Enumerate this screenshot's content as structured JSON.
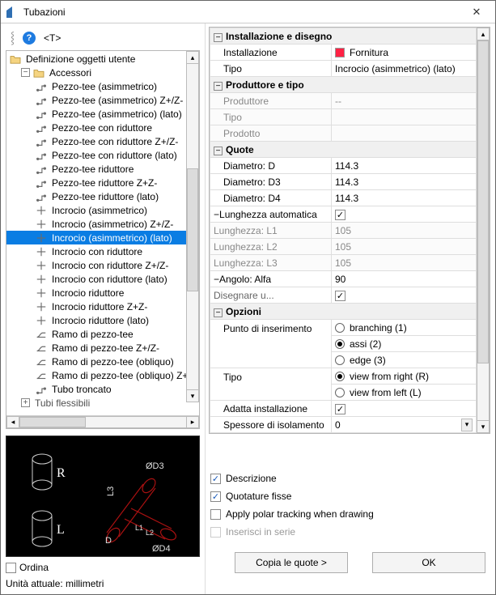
{
  "window": {
    "title": "Tubazioni"
  },
  "toolbar": {
    "t_label": "<T>"
  },
  "tree": {
    "root_label": "Definizione oggetti utente",
    "accessory_label": "Accessori",
    "cutoff_label": "Tubi flessibili",
    "items": [
      "Pezzo-tee (asimmetrico)",
      "Pezzo-tee (asimmetrico) Z+/Z-",
      "Pezzo-tee (asimmetrico) (lato)",
      "Pezzo-tee con riduttore",
      "Pezzo-tee con riduttore Z+/Z-",
      "Pezzo-tee con riduttore (lato)",
      "Pezzo-tee riduttore",
      "Pezzo-tee riduttore Z+Z-",
      "Pezzo-tee riduttore (lato)",
      "Incrocio (asimmetrico)",
      "Incrocio (asimmetrico) Z+/Z-",
      "Incrocio (asimmetrico) (lato)",
      "Incrocio con riduttore",
      "Incrocio con riduttore Z+/Z-",
      "Incrocio con riduttore (lato)",
      "Incrocio riduttore",
      "Incrocio riduttore Z+Z-",
      "Incrocio riduttore (lato)",
      "Ramo di pezzo-tee",
      "Ramo di pezzo-tee Z+/Z-",
      "Ramo di pezzo-tee (obliquo)",
      "Ramo di pezzo-tee (obliquo) Z+/Z-",
      "Tubo troncato"
    ],
    "selected_index": 11
  },
  "ordina": {
    "label": "Ordina"
  },
  "units": {
    "label": "Unità attuale: millimetri"
  },
  "grid": {
    "install_section": "Installazione e disegno",
    "install_lbl": "Installazione",
    "install_val": "Fornitura",
    "tipo_lbl": "Tipo",
    "tipo_val": "Incrocio (asimmetrico) (lato)",
    "prod_section": "Produttore e tipo",
    "produttore_lbl": "Produttore",
    "produttore_val": "--",
    "ptipo_lbl": "Tipo",
    "ptipo_val": "",
    "prodotto_lbl": "Prodotto",
    "prodotto_val": "",
    "quote_section": "Quote",
    "diam_d_lbl": "Diametro: D",
    "diam_d_val": "114.3",
    "diam_d3_lbl": "Diametro: D3",
    "diam_d3_val": "114.3",
    "diam_d4_lbl": "Diametro: D4",
    "diam_d4_val": "114.3",
    "lungh_auto_lbl": "Lunghezza automatica",
    "l1_lbl": "Lunghezza: L1",
    "l1_val": "105",
    "l2_lbl": "Lunghezza: L2",
    "l2_val": "105",
    "l3_lbl": "Lunghezza: L3",
    "l3_val": "105",
    "angolo_lbl": "Angolo: Alfa",
    "angolo_val": "90",
    "disegn_lbl": "Disegnare u...",
    "opzioni_section": "Opzioni",
    "punto_lbl": "Punto di inserimento",
    "punto_opts": {
      "branching": "branching (1)",
      "assi": "assi (2)",
      "edge": "edge (3)"
    },
    "vtipo_lbl": "Tipo",
    "vtipo_opts": {
      "right": "view from right (R)",
      "left": "view from left (L)"
    },
    "adatta_lbl": "Adatta installazione",
    "spess_lbl": "Spessore di isolamento",
    "spess_val": "0"
  },
  "checks": {
    "descr": "Descrizione",
    "quot": "Quotature fisse",
    "polar": "Apply polar tracking when drawing",
    "serie": "Inserisci in serie"
  },
  "buttons": {
    "copia": "Copia le quote >",
    "ok": "OK"
  },
  "icons": {
    "help": "?",
    "minus": "−",
    "plus": "+",
    "check": "✓",
    "left": "◂",
    "right": "▸",
    "up": "▴",
    "down": "▾"
  },
  "preview": {
    "r": "R",
    "l": "L",
    "d": "D",
    "d3": "ØD3",
    "d4": "ØD4",
    "l1": "L1",
    "l2": "L2",
    "l3": "L3"
  }
}
